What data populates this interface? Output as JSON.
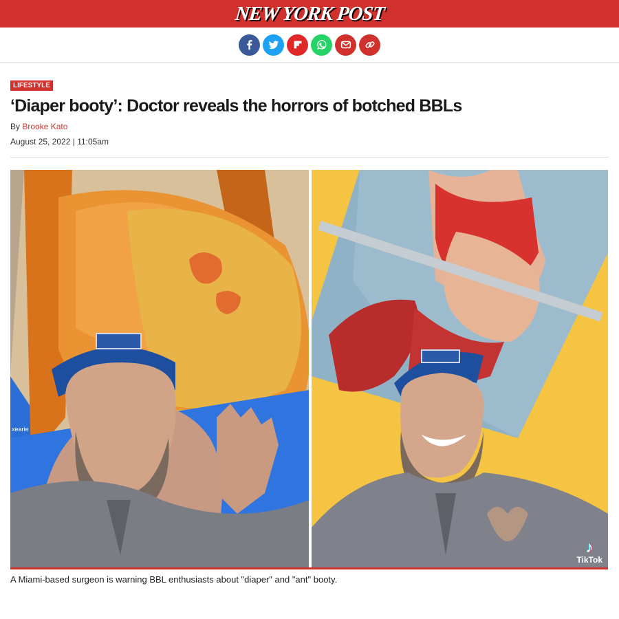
{
  "brand": {
    "name": "NEW YORK POST",
    "accent": "#d0312d"
  },
  "share": [
    {
      "name": "facebook-share-button",
      "icon": "facebook-icon",
      "color": "#3b5998"
    },
    {
      "name": "twitter-share-button",
      "icon": "twitter-icon",
      "color": "#1da1f2"
    },
    {
      "name": "flipboard-share-button",
      "icon": "flipboard-icon",
      "color": "#e12828"
    },
    {
      "name": "whatsapp-share-button",
      "icon": "whatsapp-icon",
      "color": "#25d366"
    },
    {
      "name": "email-share-button",
      "icon": "email-icon",
      "color": "#d0312d"
    },
    {
      "name": "copy-link-button",
      "icon": "link-icon",
      "color": "#d0312d"
    }
  ],
  "article": {
    "category": "LIFESTYLE",
    "headline": "‘Diaper booty’: Doctor reveals the horrors of botched BBLs",
    "by_prefix": "By",
    "author": "Brooke Kato",
    "date": "August 25, 2022 | 11:05am"
  },
  "media": {
    "left_overlay_text": "xearie",
    "right_watermark": "TikTok",
    "caption": "A Miami-based surgeon is warning BBL enthusiasts about \"diaper\" and \"ant\" booty."
  }
}
